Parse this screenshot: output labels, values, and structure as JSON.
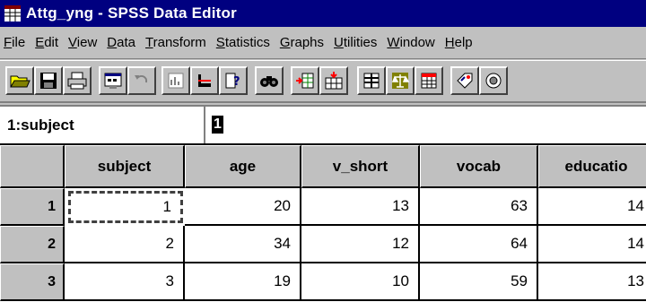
{
  "window": {
    "title": "Attg_yng - SPSS Data Editor"
  },
  "menu": [
    {
      "pre": "",
      "ul": "F",
      "post": "ile"
    },
    {
      "pre": "",
      "ul": "E",
      "post": "dit"
    },
    {
      "pre": "",
      "ul": "V",
      "post": "iew"
    },
    {
      "pre": "",
      "ul": "D",
      "post": "ata"
    },
    {
      "pre": "",
      "ul": "T",
      "post": "ransform"
    },
    {
      "pre": "",
      "ul": "S",
      "post": "tatistics"
    },
    {
      "pre": "",
      "ul": "G",
      "post": "raphs"
    },
    {
      "pre": "",
      "ul": "U",
      "post": "tilities"
    },
    {
      "pre": "",
      "ul": "W",
      "post": "indow"
    },
    {
      "pre": "",
      "ul": "H",
      "post": "elp"
    }
  ],
  "toolbar": {
    "buttons": [
      "open-icon",
      "save-icon",
      "print-icon",
      "dialog-recall-icon",
      "undo-icon",
      "goto-chart-icon",
      "goto-case-icon",
      "variables-icon",
      "find-icon",
      "insert-case-icon",
      "insert-variable-icon",
      "split-file-icon",
      "weight-cases-icon",
      "select-cases-icon",
      "value-labels-icon",
      "use-sets-icon"
    ]
  },
  "cell_editor": {
    "ref": "1:subject",
    "value": "1"
  },
  "grid": {
    "columns": [
      "subject",
      "age",
      "v_short",
      "vocab",
      "educatio"
    ],
    "rows": [
      {
        "num": "1",
        "cells": [
          "1",
          "20",
          "13",
          "63",
          "14"
        ]
      },
      {
        "num": "2",
        "cells": [
          "2",
          "34",
          "12",
          "64",
          "14"
        ]
      },
      {
        "num": "3",
        "cells": [
          "3",
          "19",
          "10",
          "59",
          "13"
        ]
      }
    ],
    "active_cell": {
      "row": 0,
      "col": 0
    }
  }
}
